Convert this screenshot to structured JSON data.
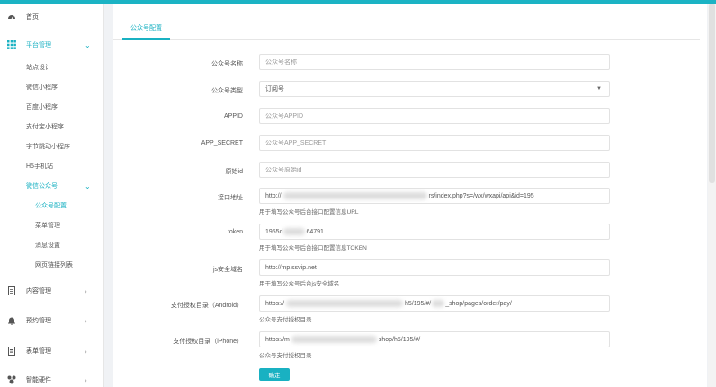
{
  "sidebar": {
    "items": [
      {
        "label": "首页",
        "icon": "dashboard-icon"
      },
      {
        "label": "平台管理",
        "icon": "grid-icon",
        "expanded": true
      },
      {
        "label": "站点设计"
      },
      {
        "label": "微信小程序"
      },
      {
        "label": "百度小程序"
      },
      {
        "label": "支付宝小程序"
      },
      {
        "label": "字节跳动小程序"
      },
      {
        "label": "H5手机站"
      },
      {
        "label": "微信公众号",
        "expanded": true
      },
      {
        "label": "公众号配置",
        "current": true
      },
      {
        "label": "菜单管理"
      },
      {
        "label": "消息设置"
      },
      {
        "label": "网页链接列表"
      },
      {
        "label": "内容管理",
        "icon": "document-icon"
      },
      {
        "label": "预约管理",
        "icon": "bell-icon"
      },
      {
        "label": "表单管理",
        "icon": "form-icon"
      },
      {
        "label": "智能硬件",
        "icon": "device-icon"
      }
    ]
  },
  "tab": {
    "label": "公众号配置"
  },
  "form": {
    "name": {
      "label": "公众号名称",
      "placeholder": "公众号名称"
    },
    "type": {
      "label": "公众号类型",
      "value": "订阅号"
    },
    "appid": {
      "label": "APPID",
      "placeholder": "公众号APPID"
    },
    "app_secret": {
      "label": "APP_SECRET",
      "placeholder": "公众号APP_SECRET"
    },
    "original_id": {
      "label": "原始id",
      "placeholder": "公众号原始id"
    },
    "api_url": {
      "label": "接口地址",
      "value_start": "http://",
      "value_end": "rs/index.php?s=/wx/wxapi/api&id=195",
      "hint": "用于填写公众号后台接口配置信息URL"
    },
    "token": {
      "label": "token",
      "value_start": "1955d",
      "value_end": "64791",
      "hint": "用于填写公众号后台接口配置信息TOKEN"
    },
    "js_domain": {
      "label": "js安全域名",
      "value": "http://mp.ssvip.net",
      "hint": "用于填写公众号后台js安全域名"
    },
    "pay_android": {
      "label": "支付授权目录（Android）",
      "value_start": "https://",
      "value_mid": "h5/195/#/",
      "value_end": "_shop/pages/order/pay/",
      "hint": "公众号支付授权目录"
    },
    "pay_iphone": {
      "label": "支付授权目录（iPhone）",
      "value_start": "https://m",
      "value_end": "shop/h5/195/#/",
      "hint": "公众号支付授权目录"
    },
    "submit_label": "确定"
  },
  "colors": {
    "accent": "#19b1c2",
    "topbar": "#1bb3c4"
  }
}
